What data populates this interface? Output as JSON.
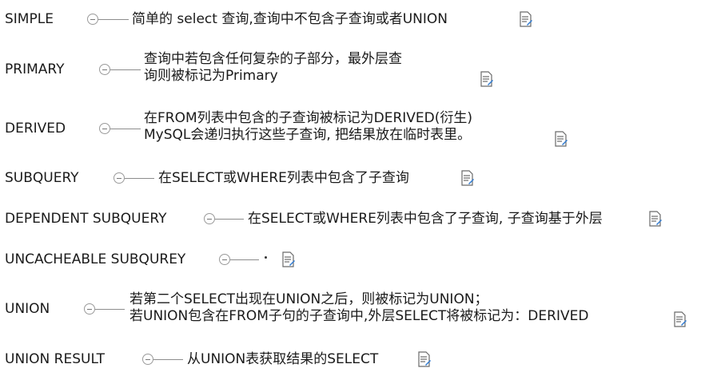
{
  "rows": [
    {
      "label": "SIMPLE",
      "lines": [
        "简单的 select 查询,查询中不包含子查询或者UNION"
      ]
    },
    {
      "label": "PRIMARY",
      "lines": [
        "查询中若包含任何复杂的子部分，最外层查",
        "询则被标记为Primary"
      ]
    },
    {
      "label": "DERIVED",
      "lines": [
        "在FROM列表中包含的子查询被标记为DERIVED(衍生)",
        "MySQL会递归执行这些子查询, 把结果放在临时表里。"
      ]
    },
    {
      "label": "SUBQUERY",
      "lines": [
        "在SELECT或WHERE列表中包含了子查询"
      ]
    },
    {
      "label": "DEPENDENT SUBQUERY",
      "lines": [
        "在SELECT或WHERE列表中包含了子查询, 子查询基于外层"
      ]
    },
    {
      "label": "UNCACHEABLE SUBQUREY",
      "lines": []
    },
    {
      "label": "UNION",
      "lines": [
        "若第二个SELECT出现在UNION之后，则被标记为UNION；",
        "若UNION包含在FROM子句的子查询中,外层SELECT将被标记为：DERIVED"
      ]
    },
    {
      "label": "UNION RESULT",
      "lines": [
        "从UNION表获取结果的SELECT"
      ]
    }
  ],
  "icons": {
    "collapse": "collapse-icon",
    "note": "note-icon"
  }
}
